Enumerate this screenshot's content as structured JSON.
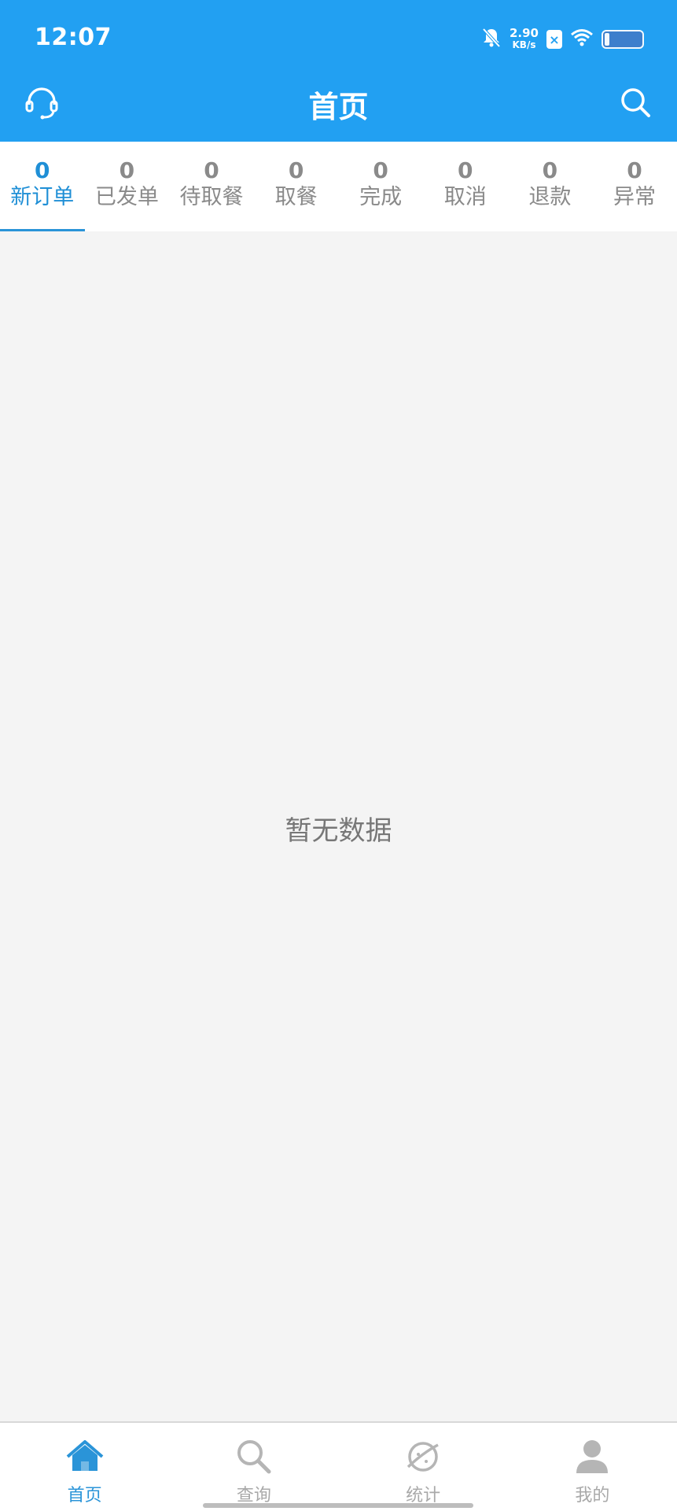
{
  "status": {
    "time": "12:07",
    "speed_value": "2.90",
    "speed_unit": "KB/s",
    "sim_label": "×"
  },
  "header": {
    "title": "首页",
    "left_icon": "headset-icon",
    "right_icon": "search-icon"
  },
  "tabs": [
    {
      "count": "0",
      "label": "新订单"
    },
    {
      "count": "0",
      "label": "已发单"
    },
    {
      "count": "0",
      "label": "待取餐"
    },
    {
      "count": "0",
      "label": "取餐"
    },
    {
      "count": "0",
      "label": "完成"
    },
    {
      "count": "0",
      "label": "取消"
    },
    {
      "count": "0",
      "label": "退款"
    },
    {
      "count": "0",
      "label": "异常"
    }
  ],
  "main": {
    "empty_text": "暂无数据"
  },
  "bottom_nav": [
    {
      "label": "首页",
      "icon": "home-icon"
    },
    {
      "label": "查询",
      "icon": "search-icon"
    },
    {
      "label": "统计",
      "icon": "planet-icon"
    },
    {
      "label": "我的",
      "icon": "person-icon"
    }
  ],
  "colors": {
    "primary": "#22a0f2",
    "active_text": "#1f8fd6",
    "inactive_text": "#8a8a8a",
    "background": "#f4f4f4"
  }
}
